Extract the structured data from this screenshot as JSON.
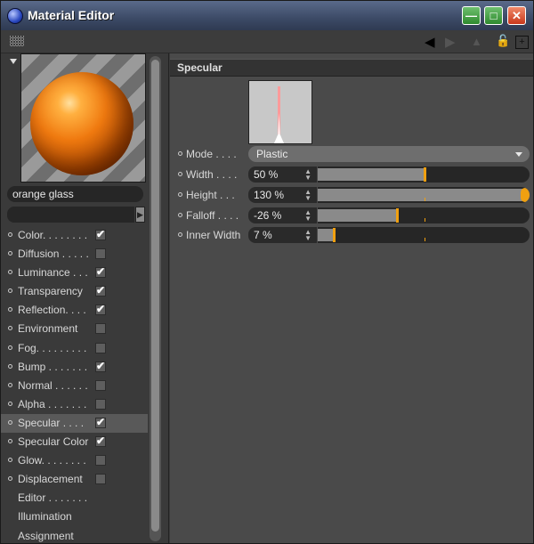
{
  "window": {
    "title": "Material Editor"
  },
  "material": {
    "name": "orange glass"
  },
  "channels": [
    {
      "label": "Color. . . . . . . .",
      "has_checkbox": true,
      "checked": true,
      "active": false
    },
    {
      "label": "Diffusion . . . . .",
      "has_checkbox": true,
      "checked": false,
      "active": false
    },
    {
      "label": "Luminance . . .",
      "has_checkbox": true,
      "checked": true,
      "active": false
    },
    {
      "label": "Transparency",
      "has_checkbox": true,
      "checked": true,
      "active": false
    },
    {
      "label": "Reflection. . . .",
      "has_checkbox": true,
      "checked": true,
      "active": false
    },
    {
      "label": "Environment",
      "has_checkbox": true,
      "checked": false,
      "active": false
    },
    {
      "label": "Fog. . . . . . . . .",
      "has_checkbox": true,
      "checked": false,
      "active": false
    },
    {
      "label": "Bump . . . . . . .",
      "has_checkbox": true,
      "checked": true,
      "active": false
    },
    {
      "label": "Normal . . . . . .",
      "has_checkbox": true,
      "checked": false,
      "active": false
    },
    {
      "label": "Alpha . . . . . . .",
      "has_checkbox": true,
      "checked": false,
      "active": false
    },
    {
      "label": "Specular . . . .",
      "has_checkbox": true,
      "checked": true,
      "active": true
    },
    {
      "label": "Specular Color",
      "has_checkbox": true,
      "checked": true,
      "active": false
    },
    {
      "label": "Glow. . . . . . . .",
      "has_checkbox": true,
      "checked": false,
      "active": false
    },
    {
      "label": "Displacement",
      "has_checkbox": true,
      "checked": false,
      "active": false
    },
    {
      "label": "Editor . . . . . . .",
      "has_checkbox": false,
      "checked": false,
      "active": false
    },
    {
      "label": "Illumination",
      "has_checkbox": false,
      "checked": false,
      "active": false
    },
    {
      "label": "Assignment",
      "has_checkbox": false,
      "checked": false,
      "active": false
    }
  ],
  "section": {
    "title": "Specular"
  },
  "mode": {
    "label": "Mode . . . .",
    "value": "Plastic"
  },
  "params": [
    {
      "label": "Width . . . .",
      "value": "50 %",
      "fraction": 0.5
    },
    {
      "label": "Height . . .",
      "value": "130 %",
      "fraction": 1.3
    },
    {
      "label": "Falloff . . . .",
      "value": "-26 %",
      "fraction": 0.37
    },
    {
      "label": "Inner Width",
      "value": "7 %",
      "fraction": 0.07
    }
  ],
  "colors": {
    "accent": "#f0a010",
    "panel": "#4a4a4a",
    "field": "#262626"
  },
  "icons": [
    "app-icon",
    "minimize-icon",
    "maximize-icon",
    "close-icon",
    "grip-icon",
    "back-arrow-icon",
    "forward-arrow-icon",
    "up-arrow-icon",
    "lock-icon",
    "new-window-icon"
  ]
}
